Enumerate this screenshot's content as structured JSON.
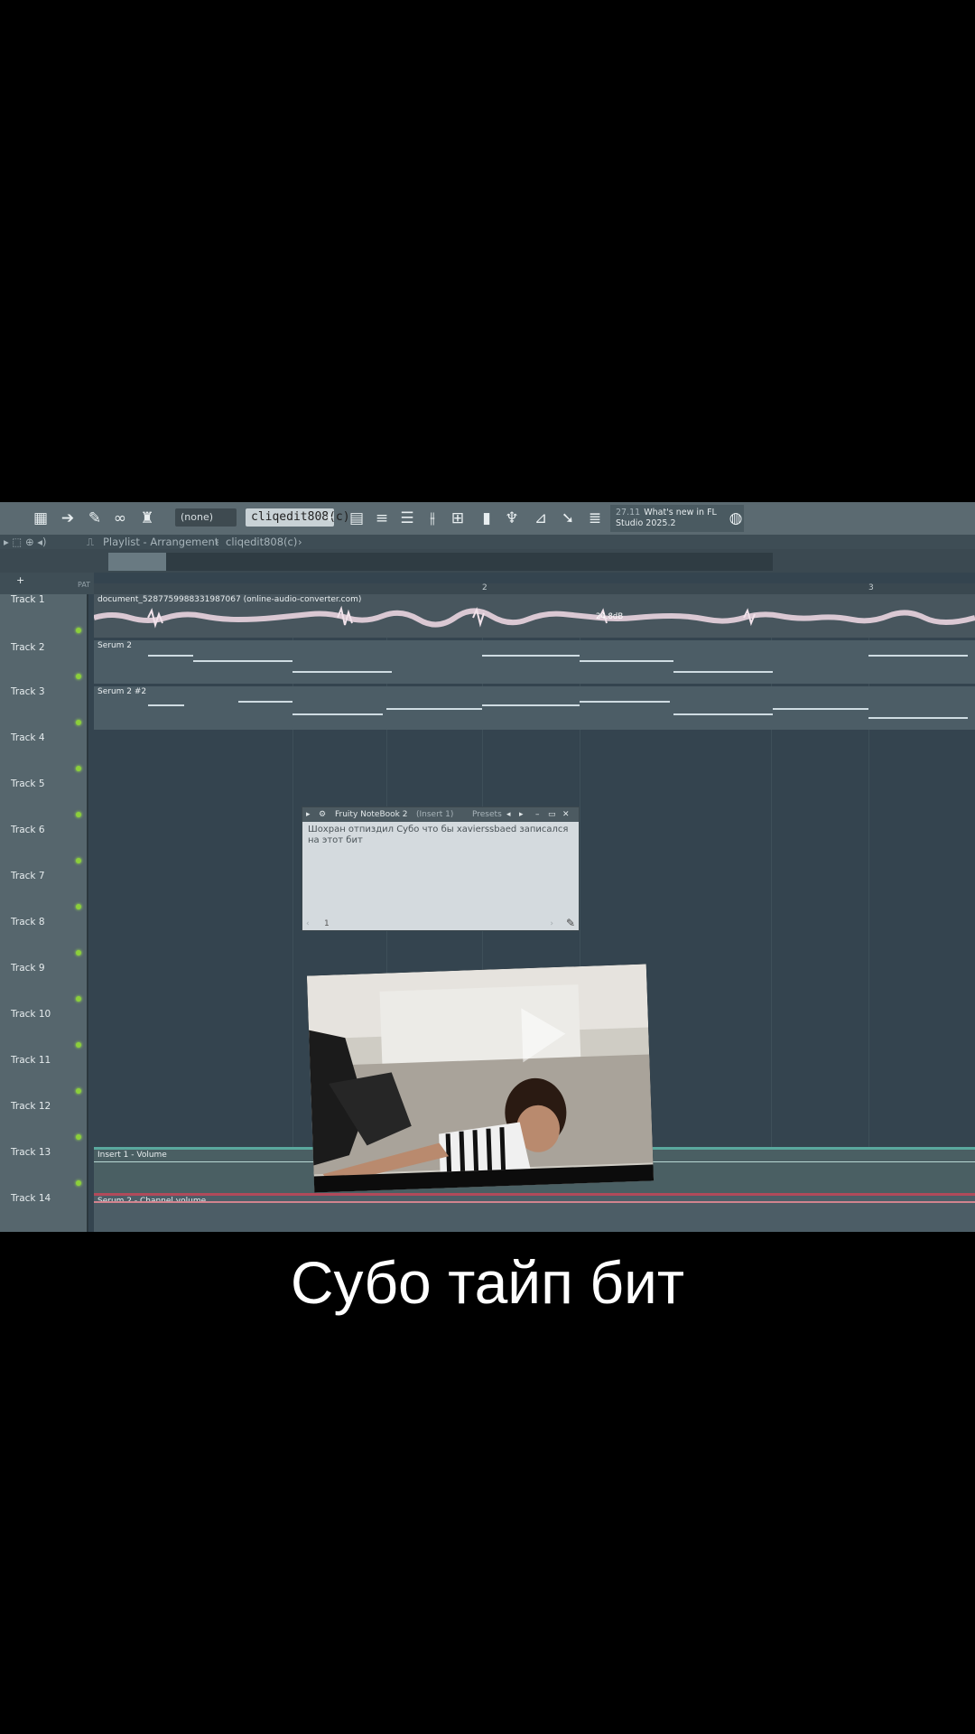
{
  "toolbar": {
    "pattern_none": "(none)",
    "pattern_name": "cliqedit808(c)",
    "plus": "+",
    "hint_number": "27.11",
    "hint_text": "What's new in FL Studio 2025.2"
  },
  "playlist": {
    "header_title": "Playlist - Arrangement",
    "header_sep": "›",
    "header_pattern": "cliqedit808(c)",
    "header_arrow": "›",
    "sidebar_labels": [
      "+",
      "PAT"
    ],
    "ruler_marks": [
      "2",
      "3"
    ]
  },
  "tracks": [
    {
      "name": "Track 1"
    },
    {
      "name": "Track 2"
    },
    {
      "name": "Track 3"
    },
    {
      "name": "Track 4"
    },
    {
      "name": "Track 5"
    },
    {
      "name": "Track 6"
    },
    {
      "name": "Track 7"
    },
    {
      "name": "Track 8"
    },
    {
      "name": "Track 9"
    },
    {
      "name": "Track 10"
    },
    {
      "name": "Track 11"
    },
    {
      "name": "Track 12"
    },
    {
      "name": "Track 13"
    },
    {
      "name": "Track 14"
    }
  ],
  "clips": {
    "audio": "document_5287759988331987067 (online-audio-converter.com)",
    "audio_level": "24.8dB",
    "serum2": "Serum 2",
    "serum2b": "Serum 2 #2",
    "insert_volume": "Insert 1 - Volume",
    "serum_channel_volume": "Serum 2 - Channel volume"
  },
  "notebook": {
    "title": "Fruity NoteBook 2",
    "title_sub": "(Insert 1)",
    "presets": "Presets",
    "text": "Шохран отпиздил Субо что бы xavierssbaed записался на этот бит",
    "page": "1"
  },
  "caption": "Субо тайп бит",
  "colors": {
    "track_bg": "#34444f",
    "led": "#8ccf3a",
    "clip_red": "#b14a5a",
    "clip_teal": "#5aa89e"
  }
}
